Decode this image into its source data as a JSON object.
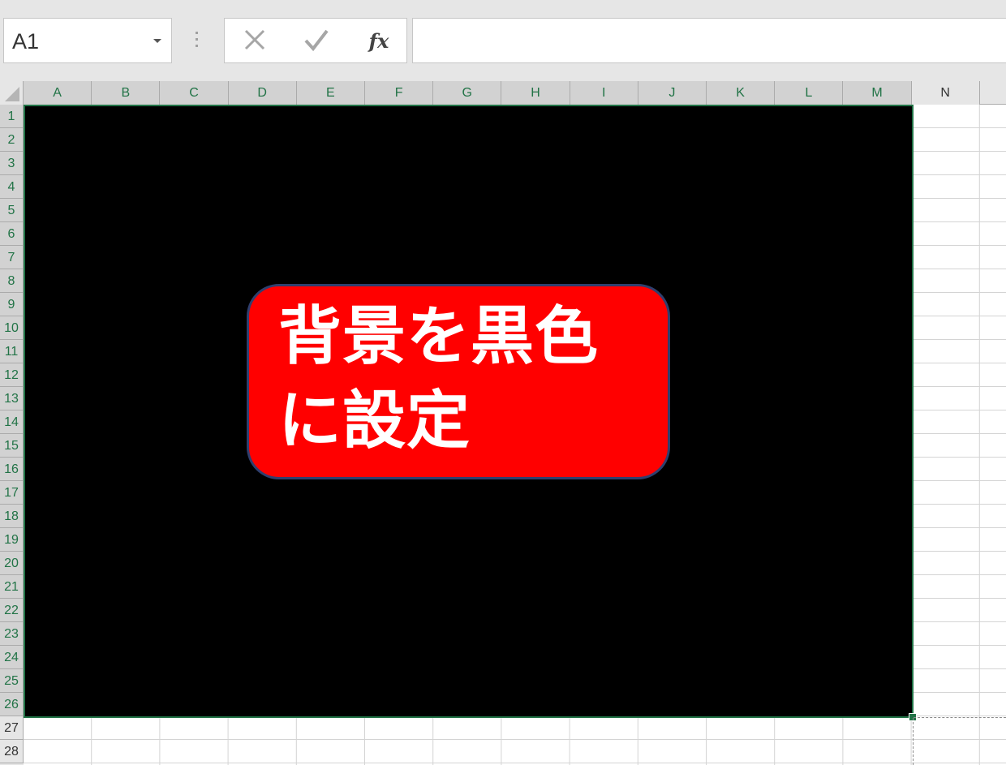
{
  "formula_bar": {
    "name_box_value": "A1",
    "cancel_icon": "close-icon",
    "enter_icon": "check-icon",
    "insert_function_label": "fx",
    "formula_value": ""
  },
  "columns": [
    "A",
    "B",
    "C",
    "D",
    "E",
    "F",
    "G",
    "H",
    "I",
    "J",
    "K",
    "L",
    "M",
    "N"
  ],
  "selected_columns": [
    "A",
    "B",
    "C",
    "D",
    "E",
    "F",
    "G",
    "H",
    "I",
    "J",
    "K",
    "L",
    "M"
  ],
  "rows": [
    "1",
    "2",
    "3",
    "4",
    "5",
    "6",
    "7",
    "8",
    "9",
    "10",
    "11",
    "12",
    "13",
    "14",
    "15",
    "16",
    "17",
    "18",
    "19",
    "20",
    "21",
    "22",
    "23",
    "24",
    "25",
    "26",
    "27",
    "28"
  ],
  "selected_rows": [
    "1",
    "2",
    "3",
    "4",
    "5",
    "6",
    "7",
    "8",
    "9",
    "10",
    "11",
    "12",
    "13",
    "14",
    "15",
    "16",
    "17",
    "18",
    "19",
    "20",
    "21",
    "22",
    "23",
    "24",
    "25",
    "26"
  ],
  "selection_range": "A1:M26",
  "fill_color": "#000000",
  "accent_color": "#217346",
  "callout": {
    "text": "背景を黒色に設定",
    "background_color": "#ff0000",
    "text_color": "#ffffff"
  }
}
